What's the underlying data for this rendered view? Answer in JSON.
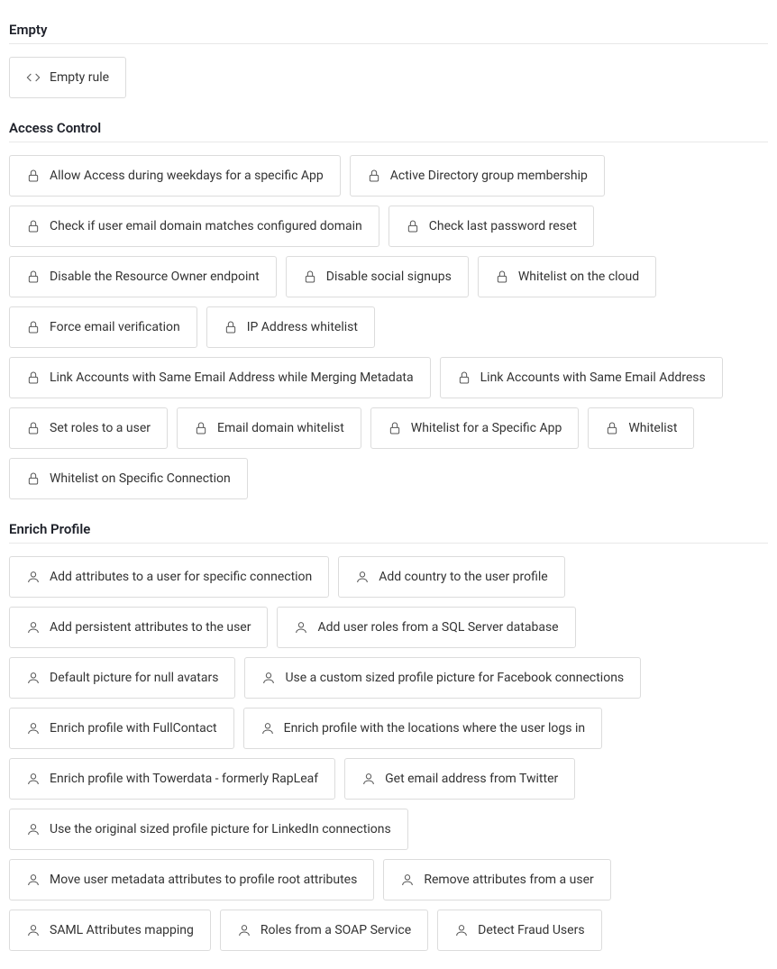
{
  "sections": {
    "empty": {
      "title": "Empty",
      "items": [
        {
          "label": "Empty rule",
          "icon": "code"
        }
      ]
    },
    "access_control": {
      "title": "Access Control",
      "items": [
        {
          "label": "Allow Access during weekdays for a specific App",
          "icon": "lock"
        },
        {
          "label": "Active Directory group membership",
          "icon": "lock"
        },
        {
          "label": "Check if user email domain matches configured domain",
          "icon": "lock"
        },
        {
          "label": "Check last password reset",
          "icon": "lock"
        },
        {
          "label": "Disable the Resource Owner endpoint",
          "icon": "lock"
        },
        {
          "label": "Disable social signups",
          "icon": "lock"
        },
        {
          "label": "Whitelist on the cloud",
          "icon": "lock"
        },
        {
          "label": "Force email verification",
          "icon": "lock"
        },
        {
          "label": "IP Address whitelist",
          "icon": "lock"
        },
        {
          "label": "Link Accounts with Same Email Address while Merging Metadata",
          "icon": "lock"
        },
        {
          "label": "Link Accounts with Same Email Address",
          "icon": "lock"
        },
        {
          "label": "Set roles to a user",
          "icon": "lock"
        },
        {
          "label": "Email domain whitelist",
          "icon": "lock"
        },
        {
          "label": "Whitelist for a Specific App",
          "icon": "lock"
        },
        {
          "label": "Whitelist",
          "icon": "lock"
        },
        {
          "label": "Whitelist on Specific Connection",
          "icon": "lock"
        }
      ]
    },
    "enrich_profile": {
      "title": "Enrich Profile",
      "items": [
        {
          "label": "Add attributes to a user for specific connection",
          "icon": "user"
        },
        {
          "label": "Add country to the user profile",
          "icon": "user"
        },
        {
          "label": "Add persistent attributes to the user",
          "icon": "user"
        },
        {
          "label": "Add user roles from a SQL Server database",
          "icon": "user"
        },
        {
          "label": "Default picture for null avatars",
          "icon": "user"
        },
        {
          "label": "Use a custom sized profile picture for Facebook connections",
          "icon": "user"
        },
        {
          "label": "Enrich profile with FullContact",
          "icon": "user"
        },
        {
          "label": "Enrich profile with the locations where the user logs in",
          "icon": "user"
        },
        {
          "label": "Enrich profile with Towerdata - formerly RapLeaf",
          "icon": "user"
        },
        {
          "label": "Get email address from Twitter",
          "icon": "user"
        },
        {
          "label": "Use the original sized profile picture for LinkedIn connections",
          "icon": "user"
        },
        {
          "label": "Move user metadata attributes to profile root attributes",
          "icon": "user"
        },
        {
          "label": "Remove attributes from a user",
          "icon": "user"
        },
        {
          "label": "SAML Attributes mapping",
          "icon": "user"
        },
        {
          "label": "Roles from a SOAP Service",
          "icon": "user"
        },
        {
          "label": "Detect Fraud Users",
          "icon": "user"
        }
      ]
    }
  }
}
